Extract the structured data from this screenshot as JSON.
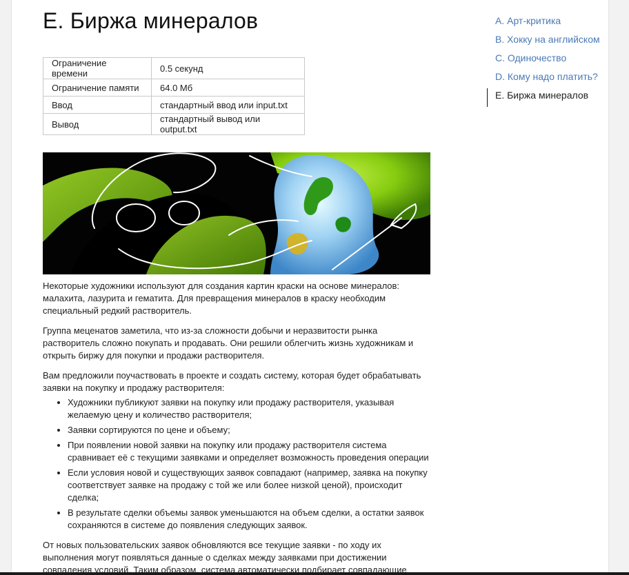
{
  "problem": {
    "title": "E. Биржа минералов",
    "limits": [
      {
        "label": "Ограничение времени",
        "value": "0.5 секунд"
      },
      {
        "label": "Ограничение памяти",
        "value": "64.0 Мб"
      },
      {
        "label": "Ввод",
        "value": "стандартный ввод или input.txt"
      },
      {
        "label": "Вывод",
        "value": "стандартный вывод или output.txt"
      }
    ],
    "paragraphs": [
      "Некоторые художники используют для создания картин краски на основе минералов: малахита, лазурита и гематита. Для превращения минералов в краску необходим специальный редкий растворитель.",
      "Группа меценатов заметила, что из-за сложности добычи и неразвитости рынка растворитель сложно покупать и продавать. Они решили облегчить жизнь художникам и открыть биржу для покупки и продажи растворителя.",
      "Вам предложили поучаствовать в проекте и создать систему, которая будет обрабатывать заявки на покупку и продажу растворителя:"
    ],
    "list": [
      "Художники публикуют заявки на покупку или продажу растворителя, указывая желаемую цену и количество растворителя;",
      "Заявки сортируются по цене и объему;",
      "При появлении новой заявки на покупку или продажу растворителя система сравнивает её с текущими заявками и определяет возможность проведения операции",
      "Если условия новой и существующих заявок совпадают (например, заявка на покупку соответствует заявке на продажу с той же или более низкой ценой), происходит сделка;",
      "В результате сделки объемы заявок уменьшаются на объем сделки, а остатки заявок сохраняются в системе до появления следующих заявок."
    ],
    "closing": "От новых пользовательских заявок обновляются все текущие заявки - по ходу их выполнения могут появляться данные о сделках между заявками при достижении совпадения условий. Таким образом, система автоматически подбирает совпадающие предложения, проводит сделки и обновляет список заявок."
  },
  "nav": {
    "items": [
      {
        "label": "A. Арт-критика",
        "active": false
      },
      {
        "label": "B. Хокку на английском",
        "active": false
      },
      {
        "label": "C. Одиночество",
        "active": false
      },
      {
        "label": "D. Кому надо платить?",
        "active": false
      },
      {
        "label": "E. Биржа минералов",
        "active": true
      }
    ]
  },
  "colors": {
    "link": "#4a79b5",
    "banner_green": "#8ad20f",
    "banner_blue": "#8fc6f0"
  },
  "icons": {
    "banner": "paint-palette-brush-illustration"
  }
}
